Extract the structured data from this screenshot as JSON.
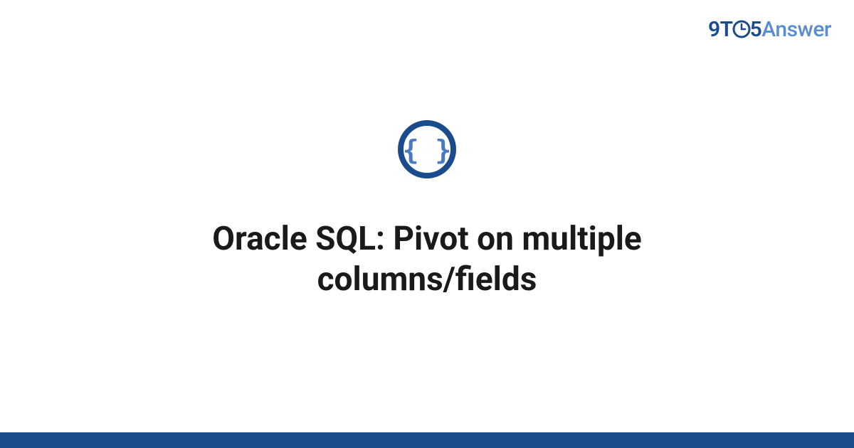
{
  "logo": {
    "part1": "9T",
    "part2": "5",
    "part3": "Answer"
  },
  "title": "Oracle SQL: Pivot on multiple columns/fields",
  "colors": {
    "primary": "#1a4b8c",
    "secondary": "#5a8dd0",
    "icon_inner": "#4a7bc0"
  }
}
